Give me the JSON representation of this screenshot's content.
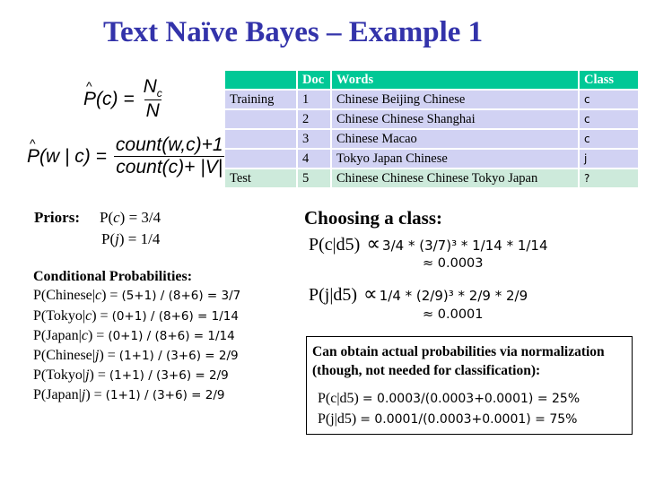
{
  "title": "Text Naïve Bayes – Example 1",
  "formulas": {
    "prior": {
      "lhs": "P(c) =",
      "numerator": "Nc",
      "denominator": "N"
    },
    "likelihood": {
      "lhs": "P(w | c) =",
      "numerator": "count(w,c)+1",
      "denominator": "count(c)+ |V|"
    }
  },
  "table": {
    "headers": [
      "",
      "Doc",
      "Words",
      "Class"
    ],
    "rows": [
      {
        "set": "Training",
        "doc": "1",
        "words": "Chinese Beijing Chinese",
        "class": "c"
      },
      {
        "set": "",
        "doc": "2",
        "words": "Chinese Chinese Shanghai",
        "class": "c"
      },
      {
        "set": "",
        "doc": "3",
        "words": "Chinese Macao",
        "class": "c"
      },
      {
        "set": "",
        "doc": "4",
        "words": "Tokyo Japan Chinese",
        "class": "j"
      },
      {
        "set": "Test",
        "doc": "5",
        "words": "Chinese Chinese Chinese Tokyo Japan",
        "class": "?"
      }
    ],
    "colors": {
      "header": "#00c896",
      "training": "#d1d2f3",
      "test": "#cdeadb"
    }
  },
  "priors": {
    "label": "Priors:",
    "items": [
      {
        "lhs_pre": "P(",
        "var": "c",
        "lhs_post": ") = 3/4"
      },
      {
        "lhs_pre": "P(",
        "var": "j",
        "lhs_post": ") = 1/4"
      }
    ]
  },
  "conditional": {
    "title": "Conditional Probabilities:",
    "items": [
      {
        "word": "P(Chinese|",
        "cls": "c",
        "close": ") =",
        "rhs": "(5+1) / (8+6) = 3/7"
      },
      {
        "word": "P(Tokyo|",
        "cls": "c",
        "close": ") =",
        "rhs": "(0+1) / (8+6) = 1/14"
      },
      {
        "word": "P(Japan|",
        "cls": "c",
        "close": ") =",
        "rhs": "(0+1) / (8+6) = 1/14"
      },
      {
        "word": "P(Chinese|",
        "cls": "j",
        "close": ") =",
        "rhs": "(1+1) / (3+6) = 2/9"
      },
      {
        "word": "P(Tokyo|",
        "cls": "j",
        "close": ") =",
        "rhs": "(1+1) / (3+6) = 2/9"
      },
      {
        "word": "P(Japan|",
        "cls": "j",
        "close": ") =",
        "rhs": "(1+1) / (3+6) = 2/9"
      }
    ]
  },
  "choosing": {
    "title": "Choosing a class:",
    "lines": [
      {
        "lhs": "P(c|d5)",
        "symbol": "∝",
        "rhs": "3/4 * (3/7)³ * 1/14 * 1/14",
        "approx": "≈ 0.0003"
      },
      {
        "lhs": "P(j|d5)",
        "symbol": "∝",
        "rhs": "1/4 * (2/9)³ * 2/9 * 2/9",
        "approx": "≈ 0.0001"
      }
    ]
  },
  "normalization": {
    "text": "Can obtain actual probabilities via normalization (though, not needed for classification):",
    "lines": [
      {
        "lhs": "P(c|d5)",
        "rhs": "= 0.0003/(0.0003+0.0001) = 25%"
      },
      {
        "lhs": "P(j|d5) ",
        "rhs": "= 0.0001/(0.0003+0.0001) = 75%"
      }
    ]
  },
  "colors": {
    "title": "#3333aa"
  }
}
